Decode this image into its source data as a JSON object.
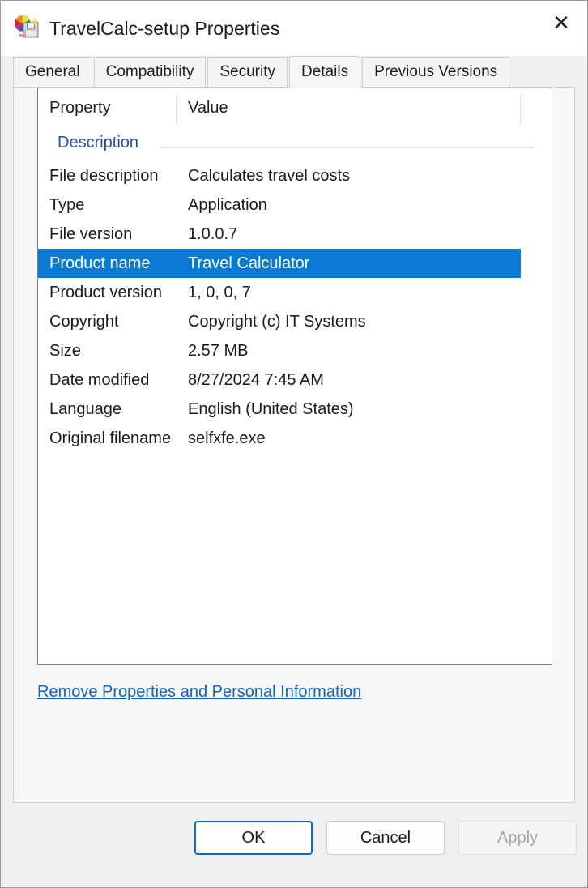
{
  "window": {
    "title": "TravelCalc-setup Properties",
    "icon": "setup-package-icon",
    "close_label": "✕"
  },
  "tabs": [
    {
      "label": "General",
      "selected": false
    },
    {
      "label": "Compatibility",
      "selected": false
    },
    {
      "label": "Security",
      "selected": false
    },
    {
      "label": "Details",
      "selected": true
    },
    {
      "label": "Previous Versions",
      "selected": false
    }
  ],
  "details": {
    "columns": {
      "property": "Property",
      "value": "Value"
    },
    "groups": [
      {
        "label": "Description",
        "rows": [
          {
            "property": "File description",
            "value": "Calculates travel costs",
            "selected": false
          },
          {
            "property": "Type",
            "value": "Application",
            "selected": false
          },
          {
            "property": "File version",
            "value": "1.0.0.7",
            "selected": false
          },
          {
            "property": "Product name",
            "value": "Travel Calculator",
            "selected": true
          },
          {
            "property": "Product version",
            "value": "1, 0, 0, 7",
            "selected": false
          },
          {
            "property": "Copyright",
            "value": "Copyright (c) IT Systems",
            "selected": false
          },
          {
            "property": "Size",
            "value": "2.57 MB",
            "selected": false
          },
          {
            "property": "Date modified",
            "value": "8/27/2024 7:45 AM",
            "selected": false
          },
          {
            "property": "Language",
            "value": "English (United States)",
            "selected": false
          },
          {
            "property": "Original filename",
            "value": "selfxfe.exe",
            "selected": false
          }
        ]
      }
    ]
  },
  "remove_link": "Remove Properties and Personal Information",
  "buttons": {
    "ok": "OK",
    "cancel": "Cancel",
    "apply": "Apply"
  },
  "colors": {
    "selection": "#0b7ad4",
    "link": "#0a64c8",
    "group_header": "#2b4c9b",
    "dialog_background": "#efefef",
    "page_background": "#f7f7f7",
    "accent_focus_border": "#0f6cbd"
  }
}
